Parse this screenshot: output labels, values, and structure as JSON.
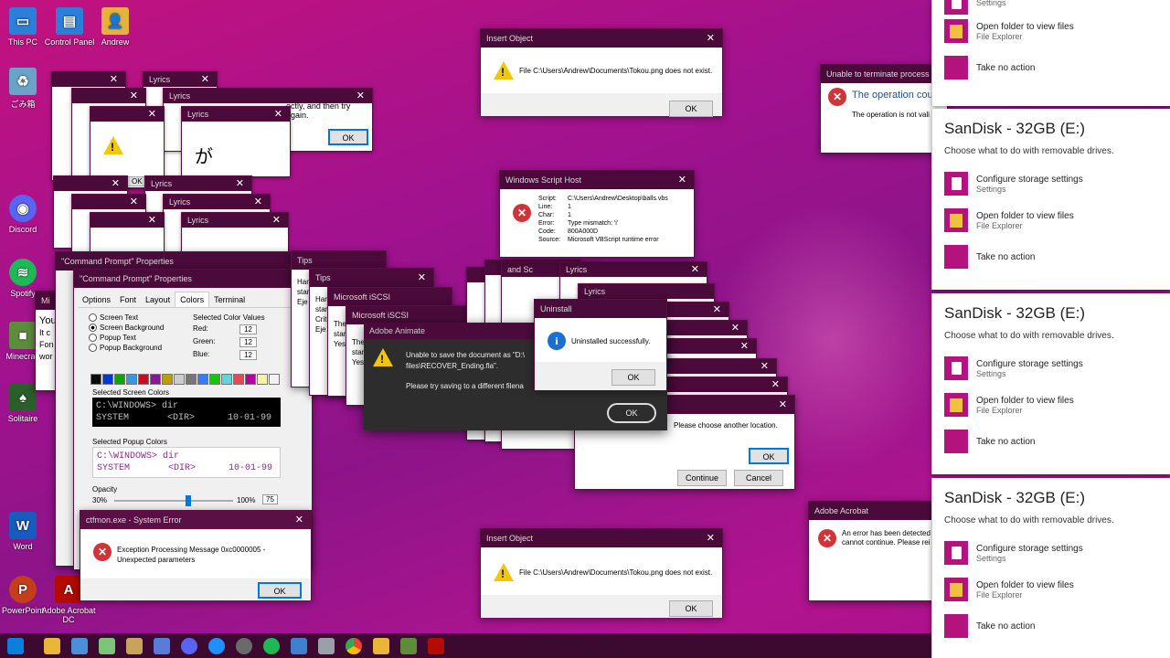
{
  "desktop_icons": [
    {
      "label": "This PC",
      "color": "#2b7fd8",
      "glyph": "pc-icon"
    },
    {
      "label": "Control Panel",
      "color": "#2b7fd8",
      "glyph": "control-panel-icon"
    },
    {
      "label": "Andrew",
      "color": "#e5b33c",
      "glyph": "user-folder-icon"
    },
    {
      "label": "ごみ箱",
      "color": "#6aa3c8",
      "glyph": "recycle-bin-icon"
    },
    {
      "label": "Discord",
      "color": "#5865f2",
      "glyph": "discord-icon"
    },
    {
      "label": "Spotify",
      "color": "#1db954",
      "glyph": "spotify-icon"
    },
    {
      "label": "Minecraft",
      "color": "#5d8c3a",
      "glyph": "minecraft-icon"
    },
    {
      "label": "Solitaire",
      "color": "#2a5e2a",
      "glyph": "solitaire-icon"
    },
    {
      "label": "Word",
      "color": "#185abd",
      "glyph": "word-icon"
    },
    {
      "label": "PowerPoint",
      "color": "#c43e1c",
      "glyph": "powerpoint-icon"
    },
    {
      "label": "Adobe Acrobat DC",
      "color": "#b30b00",
      "glyph": "acrobat-icon"
    }
  ],
  "insert_top": {
    "title": "Insert Object",
    "message": "File C:\\Users\\Andrew\\Documents\\Tokou.png does not exist.",
    "ok": "OK"
  },
  "insert_bottom": {
    "title": "Insert Object",
    "message": "File C:\\Users\\Andrew\\Documents\\Tokou.png does not exist.",
    "ok": "OK"
  },
  "terminate": {
    "title": "Unable to terminate process",
    "heading": "The operation coul",
    "body": "The operation is not vali"
  },
  "wsh": {
    "title": "Windows Script Host",
    "labels": [
      "Script:",
      "Line:",
      "Char:",
      "Error:",
      "Code:",
      "Source:"
    ],
    "values": [
      "C:\\Users\\Andrew\\Desktop\\balls.vbs",
      "1",
      "1",
      "Type mismatch: 'i'",
      "800A000D",
      "Microsoft VBScript runtime error"
    ]
  },
  "lyrics": {
    "title": "Lyrics",
    "char": "が",
    "partial": "ectly, and then try again.",
    "ok": "OK"
  },
  "cmd_props": {
    "outer_title": "\"Command Prompt\" Properties",
    "title": "\"Command Prompt\" Properties",
    "tabs": [
      "Options",
      "Font",
      "Layout",
      "Colors",
      "Terminal"
    ],
    "radios": [
      "Screen Text",
      "Screen Background",
      "Popup Text",
      "Popup Background"
    ],
    "color_values_label": "Selected Color Values",
    "red_label": "Red:",
    "green_label": "Green:",
    "blue_label": "Blue:",
    "red": "12",
    "green": "12",
    "blue": "12",
    "screen_colors_label": "Selected Screen Colors",
    "popup_colors_label": "Selected Popup Colors",
    "console_line1": "C:\\WINDOWS> dir",
    "console_line2": "SYSTEM       <DIR>      10-01-99",
    "opacity_label": "Opacity",
    "opacity_min": "30%",
    "opacity_max": "100%",
    "opacity_value": "75",
    "palette": [
      "#0c0c0c",
      "#0037da",
      "#13a10e",
      "#3a96dd",
      "#c50f1f",
      "#881798",
      "#c19c00",
      "#cccccc",
      "#767676",
      "#3b78ff",
      "#16c60c",
      "#61d6d6",
      "#e74856",
      "#b4009e",
      "#f9f1a5",
      "#f2f2f2"
    ]
  },
  "left_partial": {
    "title": "Mi",
    "lines": [
      "You",
      "It c",
      "Fon",
      "wor"
    ]
  },
  "tips": {
    "title": "Tips",
    "lines": [
      "Har",
      "star",
      "Eje"
    ]
  },
  "tips2": {
    "title": "Tips",
    "lines": [
      "Har",
      "star",
      "Crit",
      "Eje"
    ]
  },
  "iscsi": {
    "title": "Microsoft iSCSI",
    "lines": [
      "The",
      "star",
      "Yes"
    ]
  },
  "iscsi2": {
    "title": "Microsoft iSCSI",
    "lines": [
      "The",
      "star",
      "Yes"
    ]
  },
  "animate": {
    "title": "Adobe Animate",
    "line1": "Unable to save the document as \"D:\\",
    "line2": "files\\RECOVER_Ending.fla\".",
    "line3": "Please try saving to a different filena",
    "ok": "OK"
  },
  "uninstall": {
    "title": "Uninstall",
    "message": "Uninstalled successfully.",
    "ok": "OK"
  },
  "location": {
    "message": "Please choose another location.",
    "ok": "OK",
    "continue": "Continue",
    "cancel": "Cancel"
  },
  "stack_labels": {
    "and_sc": "and Sc",
    "lyrics": "Lyrics"
  },
  "ctfmon": {
    "title": "ctfmon.exe - System Error",
    "message": "Exception Processing Message 0xc0000005 - Unexpected parameters",
    "ok": "OK"
  },
  "acrobat": {
    "title": "Adobe Acrobat",
    "line1": "An error has been detected",
    "line2": "cannot continue.  Please rei"
  },
  "toast_top": {
    "settings": "Settings",
    "opt2": "Open folder to view files",
    "opt2_sub": "File Explorer",
    "opt3": "Take no action"
  },
  "toasts": [
    {
      "title": "SanDisk - 32GB (E:)",
      "sub": "Choose what to do with removable drives.",
      "opt1": "Configure storage settings",
      "opt1_sub": "Settings",
      "opt2": "Open folder to view files",
      "opt2_sub": "File Explorer",
      "opt3": "Take no action"
    },
    {
      "title": "SanDisk - 32GB (E:)",
      "sub": "Choose what to do with removable drives.",
      "opt1": "Configure storage settings",
      "opt1_sub": "Settings",
      "opt2": "Open folder to view files",
      "opt2_sub": "File Explorer",
      "opt3": "Take no action"
    },
    {
      "title": "SanDisk - 32GB (E:)",
      "sub": "Choose what to do with removable drives.",
      "opt1": "Configure storage settings",
      "opt1_sub": "Settings",
      "opt2": "Open folder to view files",
      "opt2_sub": "File Explorer",
      "opt3": "Take no action"
    }
  ],
  "taskbar_icons": [
    "start-icon",
    "file-explorer-icon",
    "folder-icon",
    "notepad-icon",
    "paint-icon",
    "image-viewer-icon",
    "discord-icon",
    "photos-icon",
    "media-icon",
    "spotify-icon",
    "control-panel-icon",
    "tool-icon",
    "chrome-icon",
    "folder-icon-2",
    "minecraft-icon",
    "acrobat-icon"
  ]
}
